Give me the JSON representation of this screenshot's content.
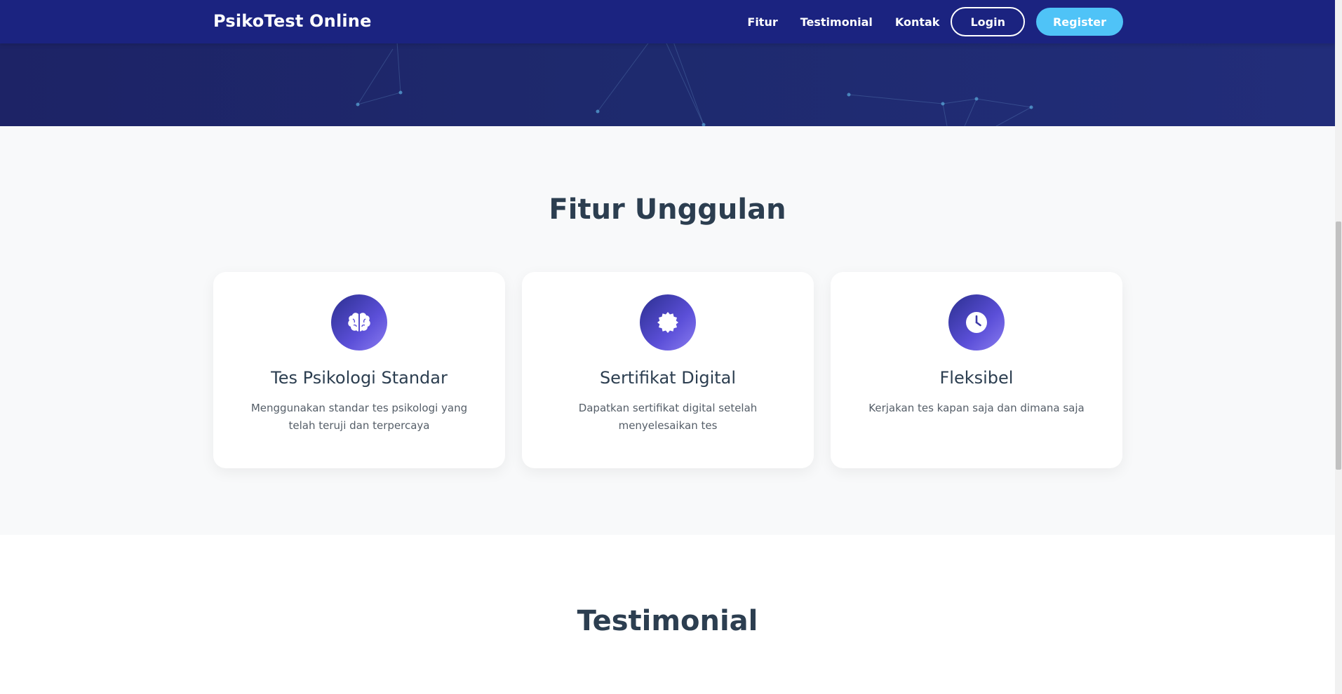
{
  "navbar": {
    "brand": "PsikoTest Online",
    "links": [
      "Fitur",
      "Testimonial",
      "Kontak"
    ],
    "login_label": "Login",
    "register_label": "Register"
  },
  "features": {
    "title": "Fitur Unggulan",
    "cards": [
      {
        "icon": "brain-icon",
        "title": "Tes Psikologi Standar",
        "description": "Menggunakan standar tes psikologi yang telah teruji dan terpercaya"
      },
      {
        "icon": "certificate-icon",
        "title": "Sertifikat Digital",
        "description": "Dapatkan sertifikat digital setelah menyelesaikan tes"
      },
      {
        "icon": "clock-icon",
        "title": "Fleksibel",
        "description": "Kerjakan tes kapan saja dan dimana saja"
      }
    ]
  },
  "testimonial": {
    "title": "Testimonial"
  },
  "colors": {
    "navbar": "#1b2380",
    "register": "#4fc3f7",
    "heading": "#2c3e50",
    "section_bg": "#f8f9fa"
  }
}
